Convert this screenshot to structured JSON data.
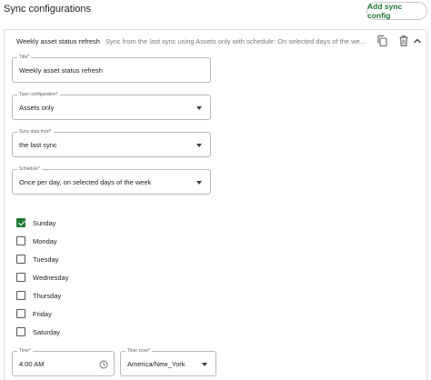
{
  "header": {
    "title": "Sync configurations",
    "add_button": "Add sync config"
  },
  "config": {
    "name": "Weekly asset status refresh",
    "description": "Sync from the last sync using Assets only with schedule: On selected days of the week, ...",
    "icons": [
      "copy-icon",
      "trash-icon",
      "chevron-up-icon"
    ]
  },
  "fields": {
    "title": {
      "label": "Title*",
      "value": "Weekly asset status refresh"
    },
    "type": {
      "label": "Type configuration*",
      "value": "Assets only"
    },
    "sync_from": {
      "label": "Sync data from*",
      "value": "the last sync"
    },
    "schedule": {
      "label": "Schedule*",
      "value": "Once per day, on selected days of the week"
    },
    "time": {
      "label": "Time*",
      "value": "4:00 AM"
    },
    "timezone": {
      "label": "Time zone*",
      "value": "America/New_York"
    }
  },
  "days": [
    {
      "label": "Sunday",
      "checked": true
    },
    {
      "label": "Monday",
      "checked": false
    },
    {
      "label": "Tuesday",
      "checked": false
    },
    {
      "label": "Wednesday",
      "checked": false
    },
    {
      "label": "Thursday",
      "checked": false
    },
    {
      "label": "Friday",
      "checked": false
    },
    {
      "label": "Saturday",
      "checked": false
    }
  ],
  "colors": {
    "accent": "#1e7a34",
    "border": "#b8b8b8"
  }
}
